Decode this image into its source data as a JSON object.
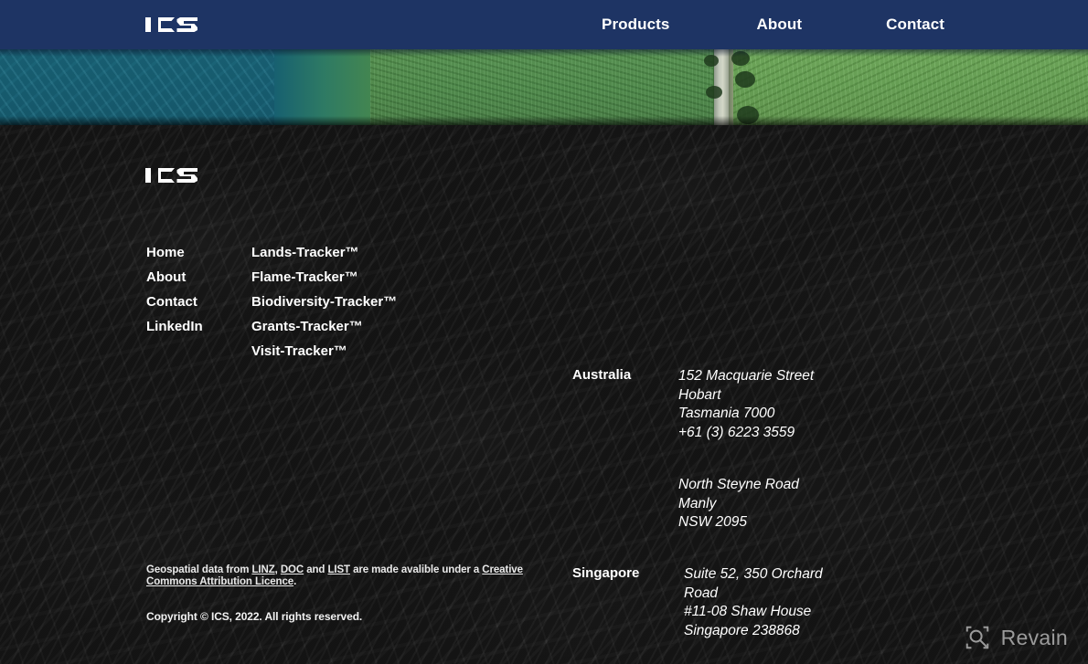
{
  "brand": {
    "name": "ICS",
    "logo_icon": "ics-wordmark-logo"
  },
  "navbar": {
    "background_color": "#1e3464",
    "links": [
      {
        "label": "Products"
      },
      {
        "label": "About"
      },
      {
        "label": "Contact"
      }
    ]
  },
  "hero": {
    "description": "aerial satellite photograph strip showing teal water, green farm fields and a road"
  },
  "footer": {
    "background_color": "#1c1c1c",
    "nav_column": [
      {
        "label": "Home"
      },
      {
        "label": "About"
      },
      {
        "label": "Contact"
      },
      {
        "label": "LinkedIn"
      }
    ],
    "products_column": [
      {
        "label": "Lands-Tracker™"
      },
      {
        "label": "Flame-Tracker™"
      },
      {
        "label": "Biodiversity-Tracker™"
      },
      {
        "label": "Grants-Tracker™"
      },
      {
        "label": "Visit-Tracker™"
      }
    ],
    "offices": [
      {
        "country": "Australia",
        "addresses": [
          {
            "lines": [
              "152 Macquarie Street",
              "Hobart",
              "Tasmania 7000",
              "+61 (3) 6223 3559"
            ]
          },
          {
            "lines": [
              "North Steyne Road",
              "Manly",
              "NSW 2095"
            ]
          }
        ]
      },
      {
        "country": "Singapore",
        "addresses": [
          {
            "lines": [
              "Suite 52, 350 Orchard",
              "Road",
              "#11-08 Shaw House",
              "Singapore 238868"
            ]
          }
        ]
      }
    ],
    "legal": {
      "attribution_prefix": "Geospatial data from ",
      "link_linz": "LINZ",
      "attribution_sep1": ", ",
      "link_doc": "DOC",
      "attribution_sep2": " and ",
      "link_list": "LIST",
      "attribution_middle": " are made avalible under a ",
      "link_licence": "Creative Commons Attribution Licence",
      "attribution_suffix": ".",
      "copyright": "Copyright © ICS, 2022. All rights reserved."
    }
  },
  "watermark": {
    "label": "Revain",
    "icon": "revain-magnifier-logo",
    "color": "#9b9b9b"
  }
}
